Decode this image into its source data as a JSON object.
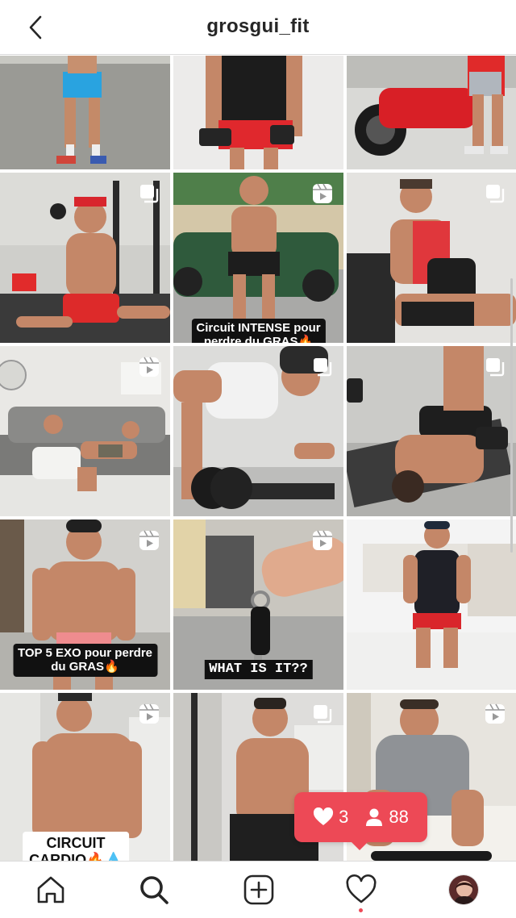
{
  "header": {
    "username": "grosgui_fit",
    "back_icon": "chevron-left-icon"
  },
  "posts": [
    {
      "type": "photo",
      "caption": ""
    },
    {
      "type": "photo",
      "caption": ""
    },
    {
      "type": "photo",
      "caption": ""
    },
    {
      "type": "carousel",
      "caption": ""
    },
    {
      "type": "reel",
      "caption": "Circuit INTENSE pour perdre du GRAS🔥"
    },
    {
      "type": "carousel",
      "caption": ""
    },
    {
      "type": "reel",
      "caption": ""
    },
    {
      "type": "carousel",
      "caption": ""
    },
    {
      "type": "carousel",
      "caption": ""
    },
    {
      "type": "reel",
      "caption": "TOP 5 EXO pour perdre du GRAS🔥"
    },
    {
      "type": "reel",
      "caption": "WHAT IS IT??"
    },
    {
      "type": "photo",
      "caption": ""
    },
    {
      "type": "reel",
      "caption": "CIRCUIT CARDIO🔥💧"
    },
    {
      "type": "carousel",
      "caption": ""
    },
    {
      "type": "reel",
      "caption": ""
    }
  ],
  "captions": {
    "c4_line1": "Circuit INTENSE pour",
    "c4_line2": "perdre du GRAS🔥",
    "c9_line1": "TOP 5 EXO pour perdre",
    "c9_line2": "du GRAS🔥",
    "c10_line1": "WHAT IS IT??",
    "c12_line1": "CIRCUIT",
    "c12_line2": "CARDIO🔥💧"
  },
  "activity_notification": {
    "likes": "3",
    "followers": "88",
    "color": "#ed4956"
  },
  "bottom_nav": {
    "items": [
      "home",
      "search",
      "new-post",
      "activity",
      "profile"
    ],
    "active": "search"
  },
  "colors": {
    "accent": "#ed4956",
    "text": "#262626",
    "divider": "#dbdbdb"
  }
}
